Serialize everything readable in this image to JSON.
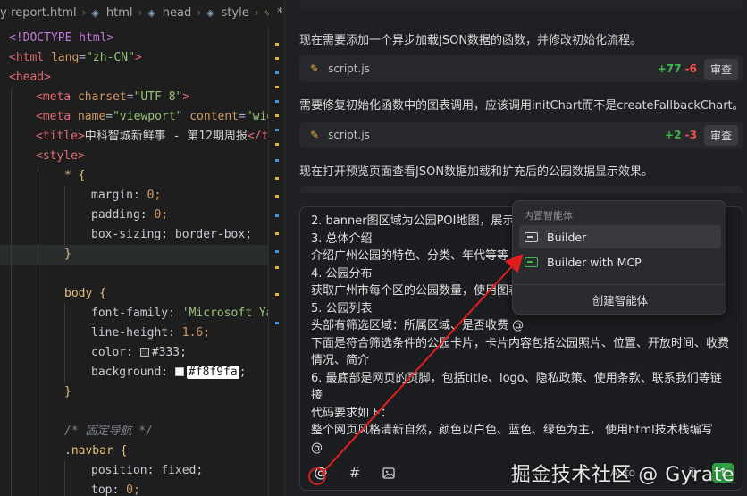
{
  "breadcrumb": {
    "file": "y-report.html",
    "items": [
      "html",
      "head",
      "style"
    ],
    "modified_marker": "*"
  },
  "code": {
    "l1": "<!DOCTYPE html>",
    "l2_tag": "<html",
    "l2_attr": "lang",
    "l2_val": "\"zh-CN\"",
    "l3": "<head>",
    "l4_tag": "<meta",
    "l4_attr": "charset",
    "l4_val": "\"UTF-8\"",
    "l5_tag": "<meta",
    "l5_attr": "name",
    "l5_val": "\"viewport\"",
    "l5_attr2": "content",
    "l5_val2": "\"wid",
    "l6_open": "<title>",
    "l6_text": "中科智城新鲜事 - 第12期周报",
    "l6_close": "</t",
    "l7": "<style>",
    "l8_sel": "* {",
    "l9_prop": "margin:",
    "l9_val": "0;",
    "l10_prop": "padding:",
    "l10_val": "0;",
    "l11_prop": "box-sizing:",
    "l11_val": "border-box;",
    "l12": "}",
    "l14_sel": "body {",
    "l15_prop": "font-family:",
    "l15_val": "'Microsoft Yah",
    "l16_prop": "line-height:",
    "l16_val": "1.6;",
    "l17_prop": "color:",
    "l17_val": "#333;",
    "l18_prop": "background:",
    "l18_val": "#f8f9fa",
    "l18_end": ";",
    "l19": "}",
    "l21": "/* 固定导航 */",
    "l22_sel": ".navbar {",
    "l23_prop": "position:",
    "l23_val": "fixed;",
    "l24_prop": "top:",
    "l24_val": "0;"
  },
  "chat": {
    "msg1": "现在需要添加一个异步加载JSON数据的函数，并修改初始化流程。",
    "card1": {
      "file": "script.js",
      "add": "+77",
      "del": "-6",
      "review": "审查"
    },
    "msg2": "需要修复初始化函数中的图表调用，应该调用initChart而不是createFallbackChart。",
    "card2": {
      "file": "script.js",
      "add": "+2",
      "del": "-3",
      "review": "审查"
    },
    "msg3": "现在打开预览页面查看JSON数据加载和扩充后的公园数据显示效果。",
    "input_lines": [
      "2. banner图区域为公园POI地图，展示",
      "3. 总体介绍",
      "介绍广州公园的特色、分类、年代等等",
      "4. 公园分布",
      "获取广州市每个区的公园数量，使用图表",
      "5. 公园列表",
      "头部有筛选区域：所属区域、是否收费 @",
      "下面是符合筛选条件的公园卡片，卡片内容包括公园照片、位置、开放时间、收费情况、简介",
      "6. 最底部是网页的页脚，包括title、logo、隐私政策、使用条款、联系我们等链接",
      "代码要求如下：",
      "整个网页风格清新自然，颜色以白色、蓝色、绿色为主， 使用html技术栈编写",
      "@"
    ],
    "toolbar": {
      "at": "@",
      "hash": "#",
      "image": "image-icon"
    },
    "auto_label": "Auto"
  },
  "popup": {
    "header": "内置智能体",
    "items": [
      {
        "label": "Builder"
      },
      {
        "label": "Builder with MCP"
      }
    ],
    "create": "创建智能体"
  },
  "watermark": "掘金技术社区 @ Gyrate",
  "colors": {
    "accent_green": "#3fb950",
    "accent_red": "#f85149",
    "arrow": "#e01e1e"
  }
}
